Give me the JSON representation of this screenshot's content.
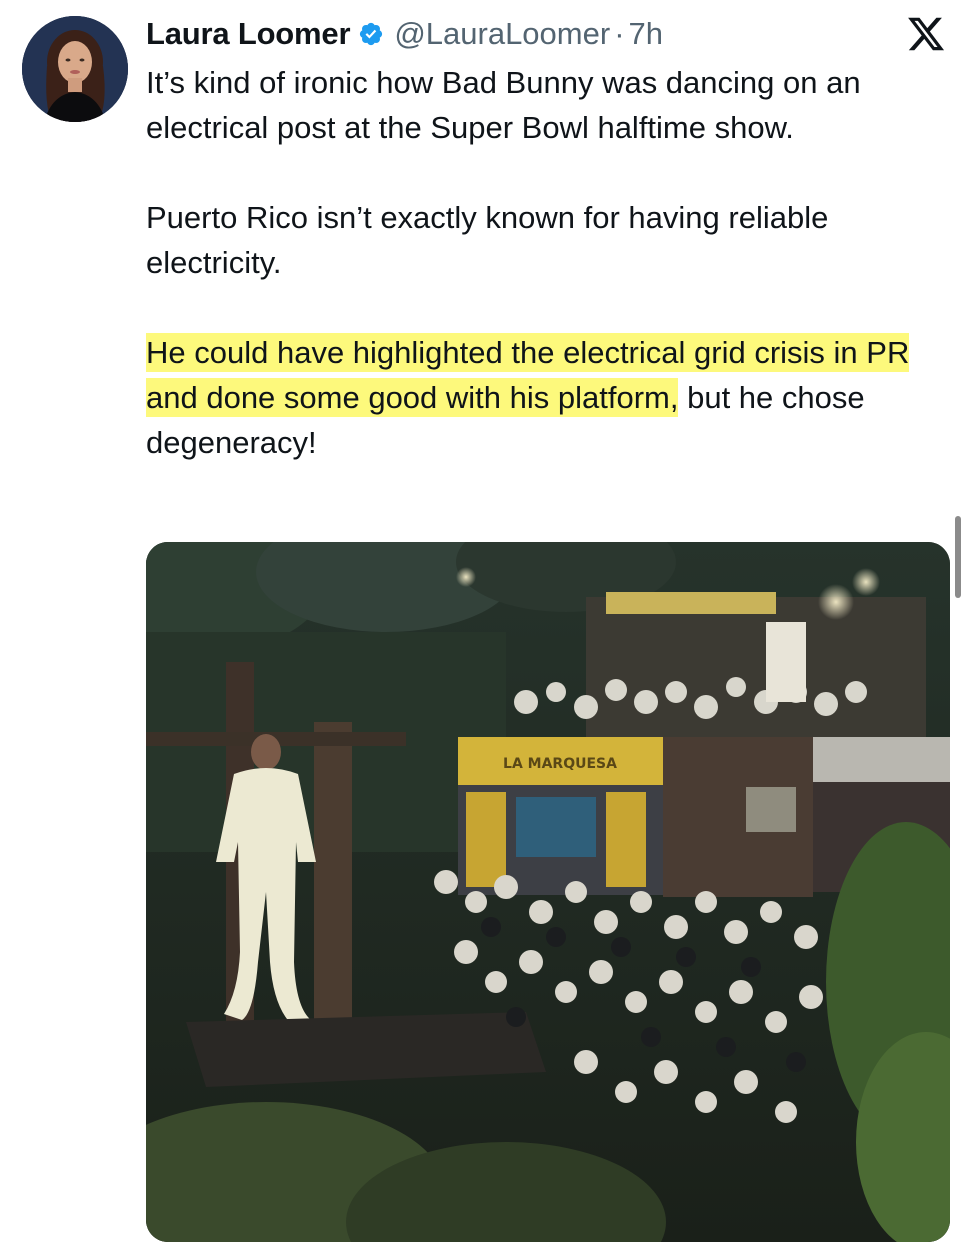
{
  "tweet": {
    "author": {
      "display_name": "Laura Loomer",
      "handle": "@LauraLoomer",
      "verified": true,
      "avatar_icon": "profile-avatar"
    },
    "separator": "·",
    "timestamp": "7h",
    "platform_icon": "x-logo-icon",
    "text": {
      "paragraph_1": "It’s kind of ironic how Bad Bunny was dancing on an electrical post at the Super Bowl halftime show.",
      "paragraph_2": "Puerto Rico isn’t exactly known for having reliable electricity.",
      "paragraph_3_highlighted": "He could have highlighted the electrical grid crisis in PR and done some good with his platform,",
      "paragraph_3_rest": " but he chose degeneracy!"
    },
    "media": {
      "type": "video-still",
      "sign_text": "LA MARQUESA"
    }
  },
  "colors": {
    "text_primary": "#0f1419",
    "text_secondary": "#536471",
    "verified_blue": "#1d9bf0",
    "highlight_yellow": "#fdf97c"
  }
}
